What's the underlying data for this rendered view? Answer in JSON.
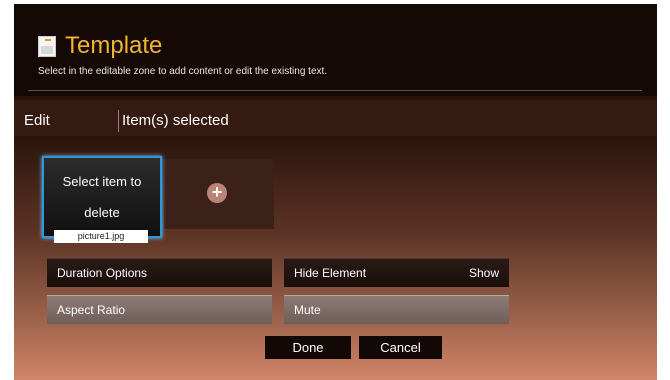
{
  "header": {
    "title": "Template",
    "subtitle": "Select in the editable zone to add content or edit the existing text."
  },
  "editbar": {
    "edit_label": "Edit",
    "selected_label": "Item(s) selected"
  },
  "item": {
    "line1": "Select item to",
    "line2": "delete",
    "filename": "picture1.jpg"
  },
  "add_icon": "plus-circle-icon",
  "options": {
    "duration": "Duration Options",
    "hide_element": "Hide Element",
    "hide_element_value": "Show",
    "aspect_ratio": "Aspect Ratio",
    "mute": "Mute"
  },
  "buttons": {
    "done": "Done",
    "cancel": "Cancel"
  },
  "colors": {
    "title": "#f2b233",
    "selection_border": "#2d98dc"
  }
}
